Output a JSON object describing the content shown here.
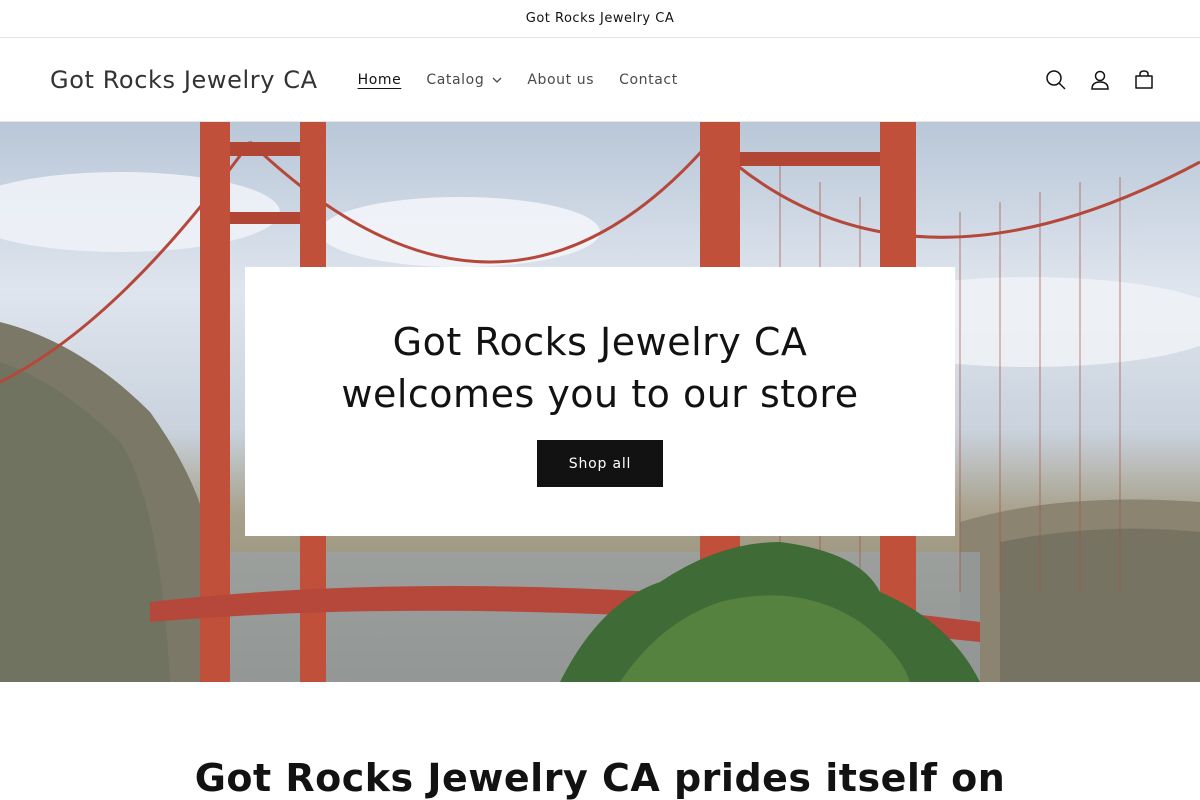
{
  "announcement": {
    "text": "Got Rocks Jewelry CA"
  },
  "header": {
    "logo": "Got Rocks Jewelry CA",
    "nav": [
      {
        "label": "Home",
        "active": true
      },
      {
        "label": "Catalog",
        "has_dropdown": true
      },
      {
        "label": "About us"
      },
      {
        "label": "Contact"
      }
    ],
    "icons": [
      "search-icon",
      "account-icon",
      "cart-icon"
    ]
  },
  "hero": {
    "title": "Got Rocks Jewelry CA welcomes you to our store",
    "button_label": "Shop all",
    "image": "golden-gate-bridge-photo"
  },
  "intro": {
    "heading": "Got Rocks Jewelry CA prides itself on"
  },
  "colors": {
    "button": "#121212",
    "text": "#121212",
    "bridge": "#c0503a"
  }
}
